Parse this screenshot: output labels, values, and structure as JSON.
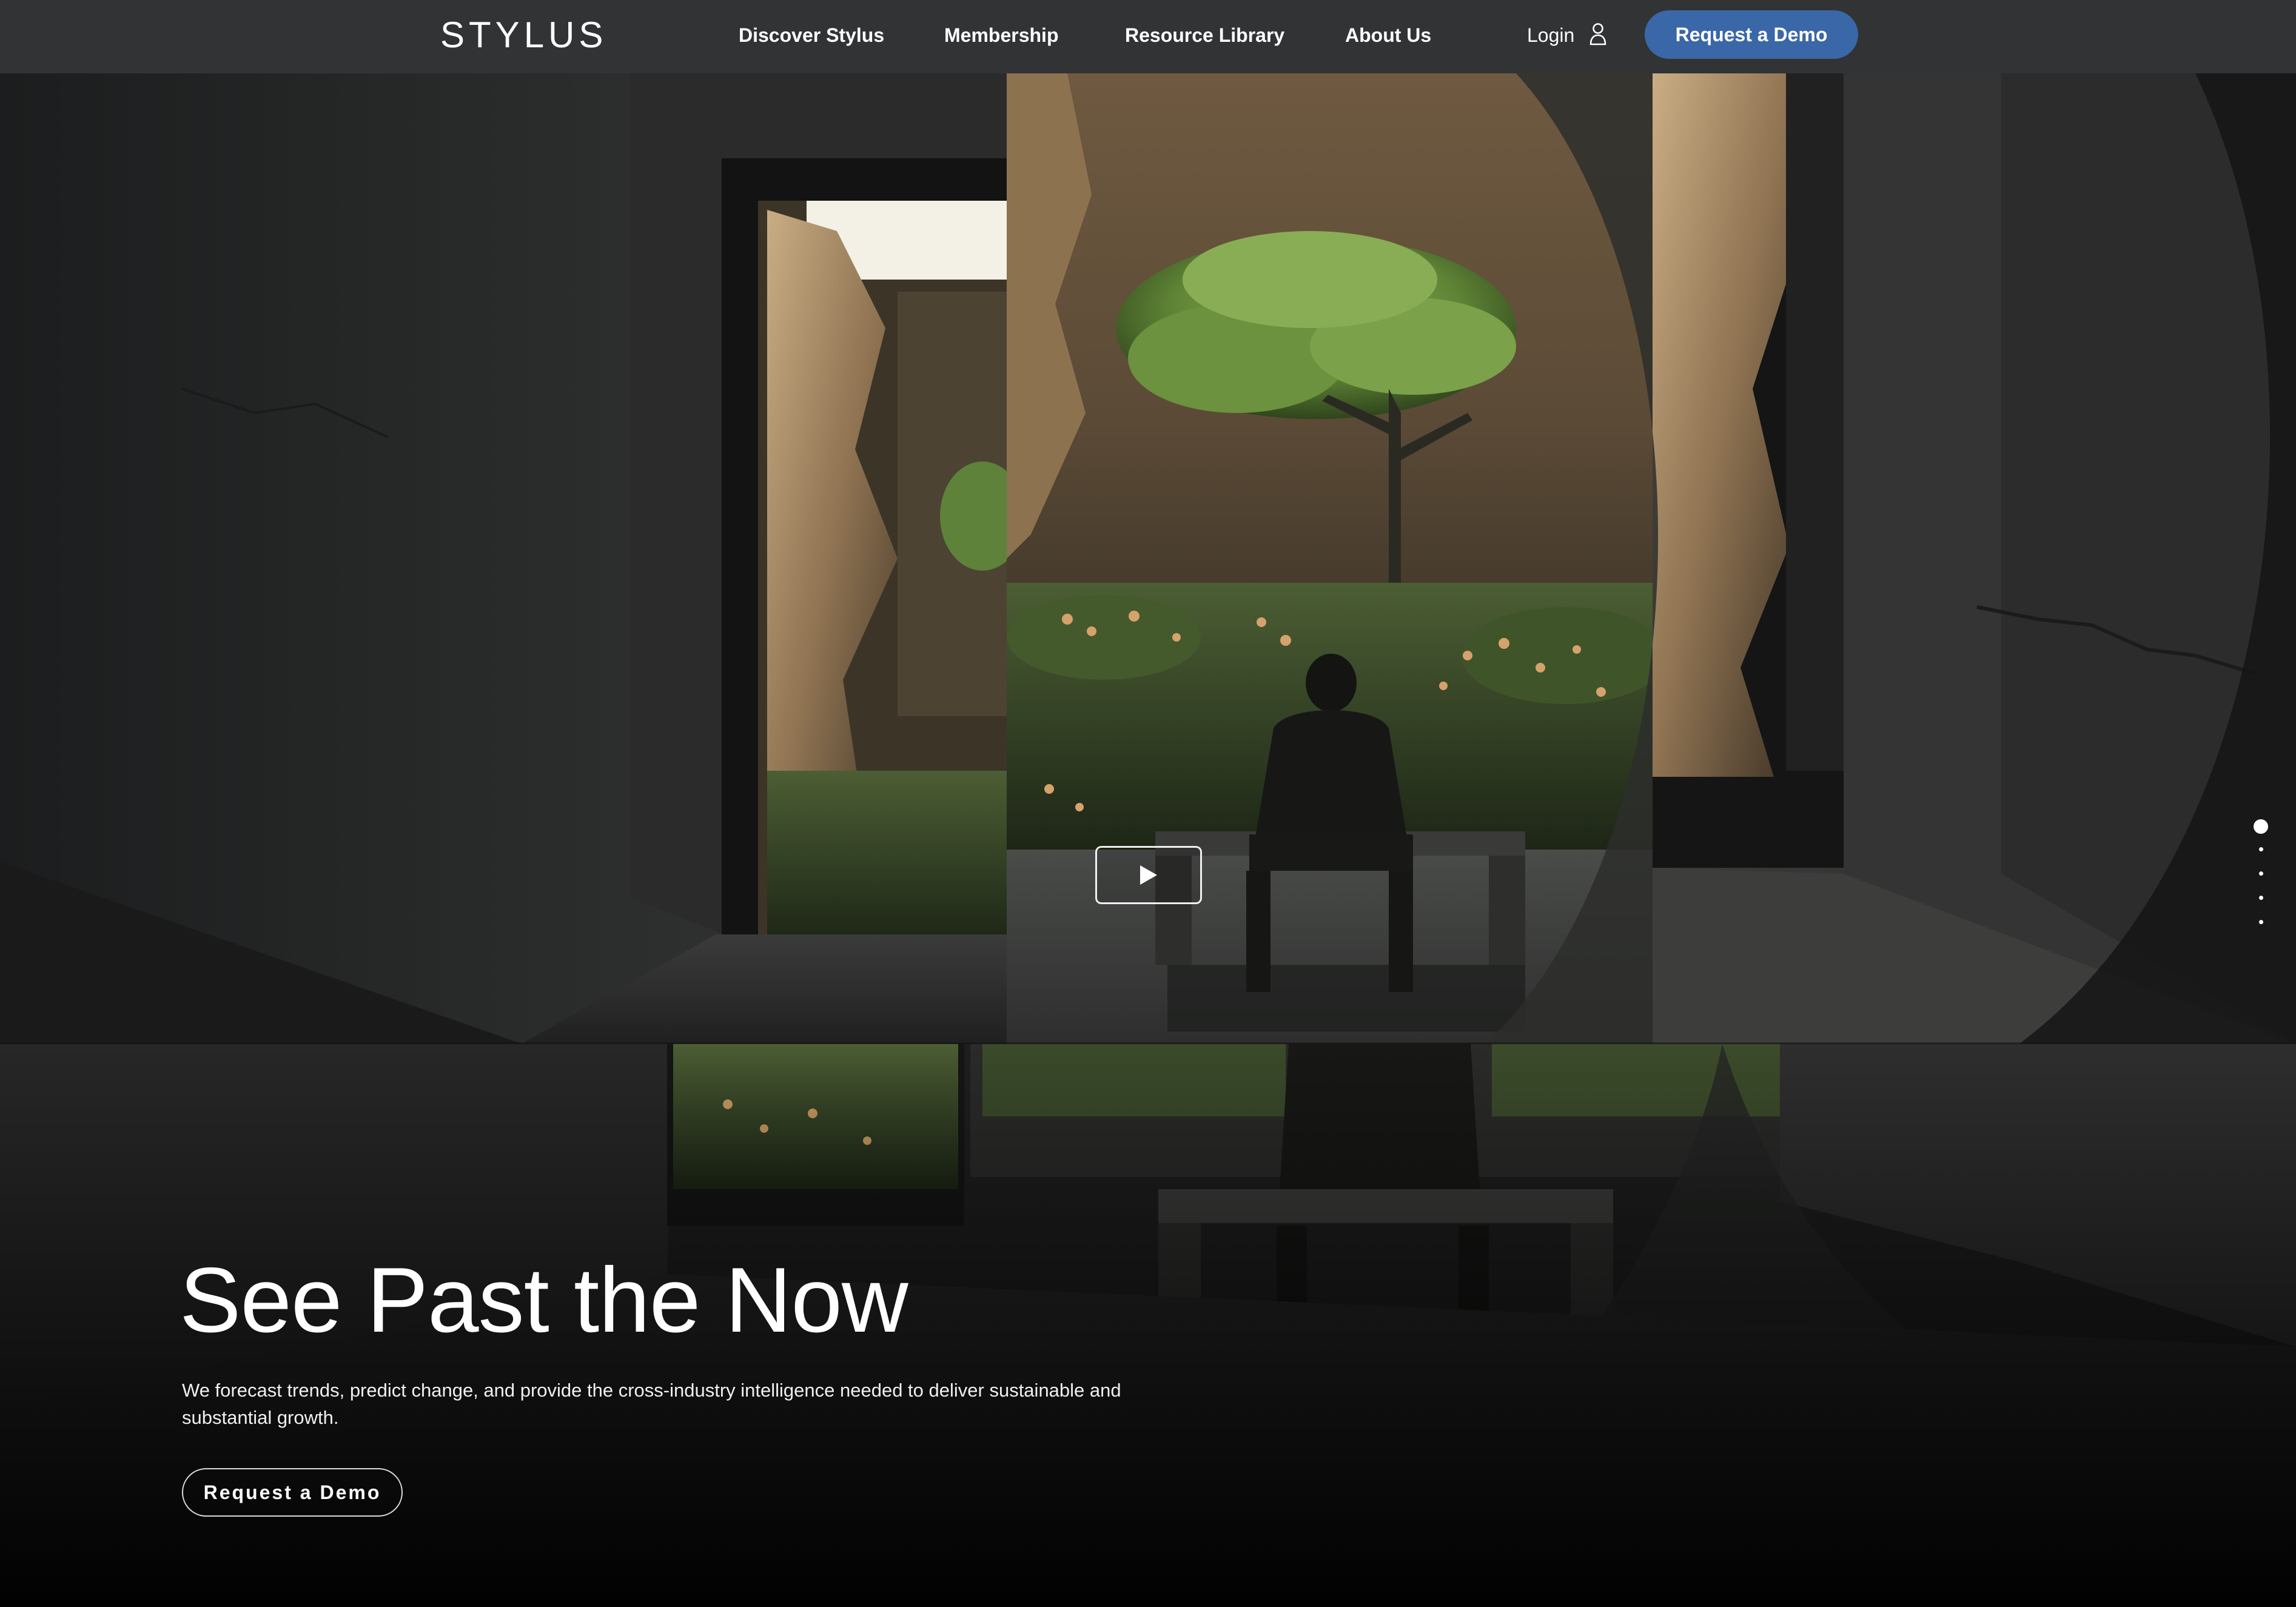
{
  "header": {
    "logo": "STYLUS",
    "nav": [
      {
        "label": "Discover Stylus"
      },
      {
        "label": "Membership"
      },
      {
        "label": "Resource Library"
      },
      {
        "label": "About Us"
      }
    ],
    "login_label": "Login",
    "login_icon": "user-icon",
    "demo_label": "Request a Demo",
    "demo_color": "#3a67a8"
  },
  "hero": {
    "headline": "See Past the Now",
    "subcopy": "We forecast trends, predict change, and provide the cross-industry intelligence needed to deliver sustainable and substantial growth.",
    "cta_label": "Request a Demo",
    "play_icon": "play-icon",
    "pager": {
      "total": 5,
      "active": 1
    }
  },
  "colors": {
    "header_bg": "#313335",
    "page_bg": "#050505",
    "foliage": "#6e8f3d",
    "rock": "#8a6d47"
  }
}
